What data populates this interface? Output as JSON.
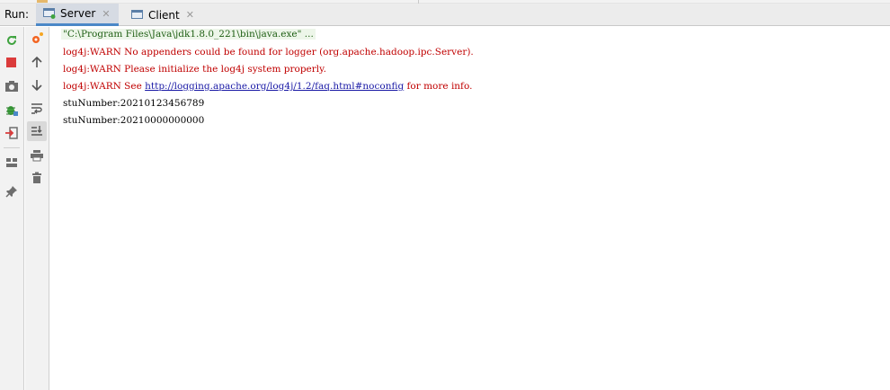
{
  "run_label": "Run:",
  "tabs": [
    {
      "label": "Server",
      "active": true
    },
    {
      "label": "Client",
      "active": false
    }
  ],
  "console": {
    "command": "\"C:\\Program Files\\Java\\jdk1.8.0_221\\bin\\java.exe\" ...",
    "warn1": "log4j:WARN No appenders could be found for logger (org.apache.hadoop.ipc.Server).",
    "warn2": "log4j:WARN Please initialize the log4j system properly.",
    "warn3_prefix": "log4j:WARN See ",
    "warn3_link": "http://logging.apache.org/log4j/1.2/faq.html#noconfig",
    "warn3_suffix": " for more info.",
    "out1": "stuNumber:20210123456789",
    "out2": "stuNumber:20210000000000"
  },
  "colors": {
    "error_text": "#c00000",
    "link": "#1a1aa6",
    "command_bg": "#edf6e9",
    "command_text": "#1f5f14",
    "active_tab_underline": "#4a88c7"
  },
  "icons": {
    "left_column": [
      "rerun-icon",
      "stop-icon",
      "camera-icon",
      "debug-icon",
      "exit-icon",
      "layout-icon",
      "pin-icon"
    ],
    "right_column": [
      "settings-icon",
      "up-arrow-icon",
      "down-arrow-icon",
      "soft-wrap-icon",
      "scroll-to-end-icon",
      "print-icon",
      "trash-icon"
    ]
  }
}
